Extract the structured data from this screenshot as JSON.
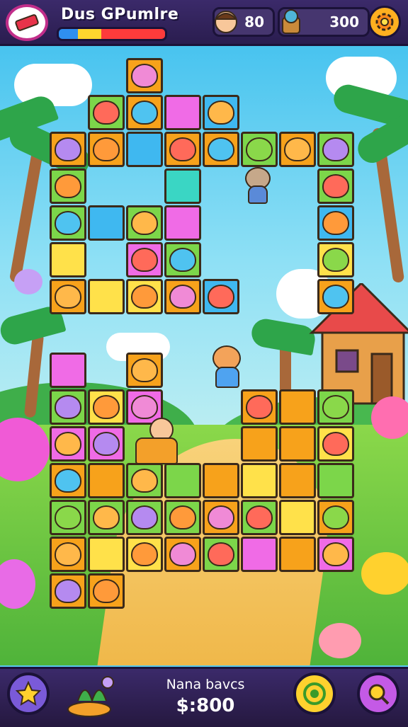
{
  "header": {
    "title": "Dus GPumlre",
    "player_count": "80",
    "coins_count": "300",
    "menu_icon": "ticket-icon",
    "settings_icon": "gear-icon"
  },
  "footer": {
    "label": "Nana bavcs",
    "value": "$:800",
    "left_icon": "star-icon",
    "center_icon": "target-icon",
    "right_icon": "magnifier-icon"
  },
  "colors": {
    "accent": "#c12e8a",
    "bar_bg": "#3b2a6a",
    "tile_orange": "#f7a21b",
    "tile_yellow": "#ffe14a",
    "tile_green": "#7cd64a",
    "tile_pink": "#f06be6",
    "tile_blue": "#3fb8f0",
    "tile_teal": "#3ad6c4"
  }
}
